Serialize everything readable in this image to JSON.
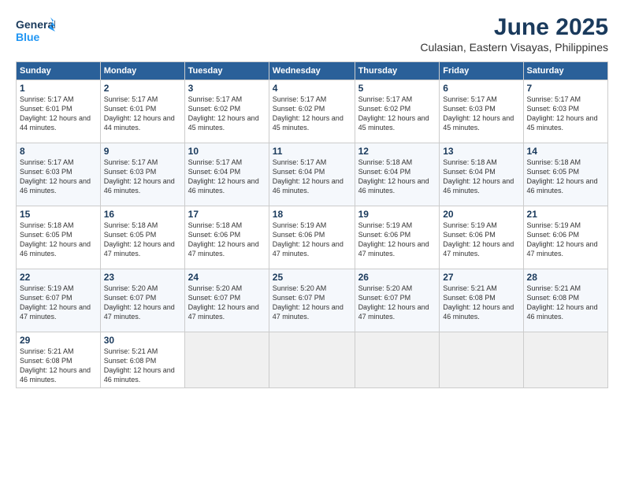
{
  "header": {
    "logo_line1": "General",
    "logo_line2": "Blue",
    "month": "June 2025",
    "location": "Culasian, Eastern Visayas, Philippines"
  },
  "days_of_week": [
    "Sunday",
    "Monday",
    "Tuesday",
    "Wednesday",
    "Thursday",
    "Friday",
    "Saturday"
  ],
  "weeks": [
    [
      {
        "day": "1",
        "sunrise": "5:17 AM",
        "sunset": "6:01 PM",
        "daylight": "12 hours and 44 minutes."
      },
      {
        "day": "2",
        "sunrise": "5:17 AM",
        "sunset": "6:01 PM",
        "daylight": "12 hours and 44 minutes."
      },
      {
        "day": "3",
        "sunrise": "5:17 AM",
        "sunset": "6:02 PM",
        "daylight": "12 hours and 45 minutes."
      },
      {
        "day": "4",
        "sunrise": "5:17 AM",
        "sunset": "6:02 PM",
        "daylight": "12 hours and 45 minutes."
      },
      {
        "day": "5",
        "sunrise": "5:17 AM",
        "sunset": "6:02 PM",
        "daylight": "12 hours and 45 minutes."
      },
      {
        "day": "6",
        "sunrise": "5:17 AM",
        "sunset": "6:03 PM",
        "daylight": "12 hours and 45 minutes."
      },
      {
        "day": "7",
        "sunrise": "5:17 AM",
        "sunset": "6:03 PM",
        "daylight": "12 hours and 45 minutes."
      }
    ],
    [
      {
        "day": "8",
        "sunrise": "5:17 AM",
        "sunset": "6:03 PM",
        "daylight": "12 hours and 46 minutes."
      },
      {
        "day": "9",
        "sunrise": "5:17 AM",
        "sunset": "6:03 PM",
        "daylight": "12 hours and 46 minutes."
      },
      {
        "day": "10",
        "sunrise": "5:17 AM",
        "sunset": "6:04 PM",
        "daylight": "12 hours and 46 minutes."
      },
      {
        "day": "11",
        "sunrise": "5:17 AM",
        "sunset": "6:04 PM",
        "daylight": "12 hours and 46 minutes."
      },
      {
        "day": "12",
        "sunrise": "5:18 AM",
        "sunset": "6:04 PM",
        "daylight": "12 hours and 46 minutes."
      },
      {
        "day": "13",
        "sunrise": "5:18 AM",
        "sunset": "6:04 PM",
        "daylight": "12 hours and 46 minutes."
      },
      {
        "day": "14",
        "sunrise": "5:18 AM",
        "sunset": "6:05 PM",
        "daylight": "12 hours and 46 minutes."
      }
    ],
    [
      {
        "day": "15",
        "sunrise": "5:18 AM",
        "sunset": "6:05 PM",
        "daylight": "12 hours and 46 minutes."
      },
      {
        "day": "16",
        "sunrise": "5:18 AM",
        "sunset": "6:05 PM",
        "daylight": "12 hours and 47 minutes."
      },
      {
        "day": "17",
        "sunrise": "5:18 AM",
        "sunset": "6:06 PM",
        "daylight": "12 hours and 47 minutes."
      },
      {
        "day": "18",
        "sunrise": "5:19 AM",
        "sunset": "6:06 PM",
        "daylight": "12 hours and 47 minutes."
      },
      {
        "day": "19",
        "sunrise": "5:19 AM",
        "sunset": "6:06 PM",
        "daylight": "12 hours and 47 minutes."
      },
      {
        "day": "20",
        "sunrise": "5:19 AM",
        "sunset": "6:06 PM",
        "daylight": "12 hours and 47 minutes."
      },
      {
        "day": "21",
        "sunrise": "5:19 AM",
        "sunset": "6:06 PM",
        "daylight": "12 hours and 47 minutes."
      }
    ],
    [
      {
        "day": "22",
        "sunrise": "5:19 AM",
        "sunset": "6:07 PM",
        "daylight": "12 hours and 47 minutes."
      },
      {
        "day": "23",
        "sunrise": "5:20 AM",
        "sunset": "6:07 PM",
        "daylight": "12 hours and 47 minutes."
      },
      {
        "day": "24",
        "sunrise": "5:20 AM",
        "sunset": "6:07 PM",
        "daylight": "12 hours and 47 minutes."
      },
      {
        "day": "25",
        "sunrise": "5:20 AM",
        "sunset": "6:07 PM",
        "daylight": "12 hours and 47 minutes."
      },
      {
        "day": "26",
        "sunrise": "5:20 AM",
        "sunset": "6:07 PM",
        "daylight": "12 hours and 47 minutes."
      },
      {
        "day": "27",
        "sunrise": "5:21 AM",
        "sunset": "6:08 PM",
        "daylight": "12 hours and 46 minutes."
      },
      {
        "day": "28",
        "sunrise": "5:21 AM",
        "sunset": "6:08 PM",
        "daylight": "12 hours and 46 minutes."
      }
    ],
    [
      {
        "day": "29",
        "sunrise": "5:21 AM",
        "sunset": "6:08 PM",
        "daylight": "12 hours and 46 minutes."
      },
      {
        "day": "30",
        "sunrise": "5:21 AM",
        "sunset": "6:08 PM",
        "daylight": "12 hours and 46 minutes."
      },
      null,
      null,
      null,
      null,
      null
    ]
  ]
}
